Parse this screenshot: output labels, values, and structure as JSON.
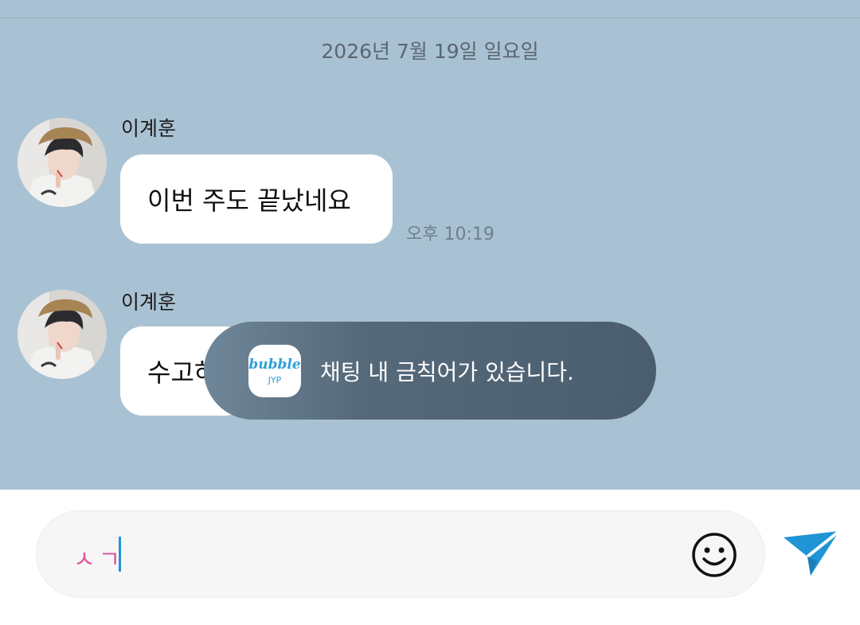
{
  "chat": {
    "date": "2026년 7월 19일 일요일",
    "messages": [
      {
        "sender": "이계훈",
        "text": "이번 주도 끝났네요",
        "time": "오후 10:19"
      },
      {
        "sender": "이계훈",
        "text": "수고하"
      }
    ]
  },
  "toast": {
    "app_icon": "bubble-app-icon",
    "app_name": "bubble",
    "app_mark": "JYP",
    "message": "채팅 내 금칙어가 있습니다."
  },
  "composer": {
    "value": "ㅅㄱ",
    "emoji_icon": "smiley-icon",
    "send_icon": "paper-plane-icon"
  },
  "colors": {
    "chat_background": "#a9c2d3",
    "bubble": "#ffffff",
    "toast_background": "#4a5e6f",
    "accent_blue": "#1f95d6",
    "input_text": "#e0559d"
  }
}
